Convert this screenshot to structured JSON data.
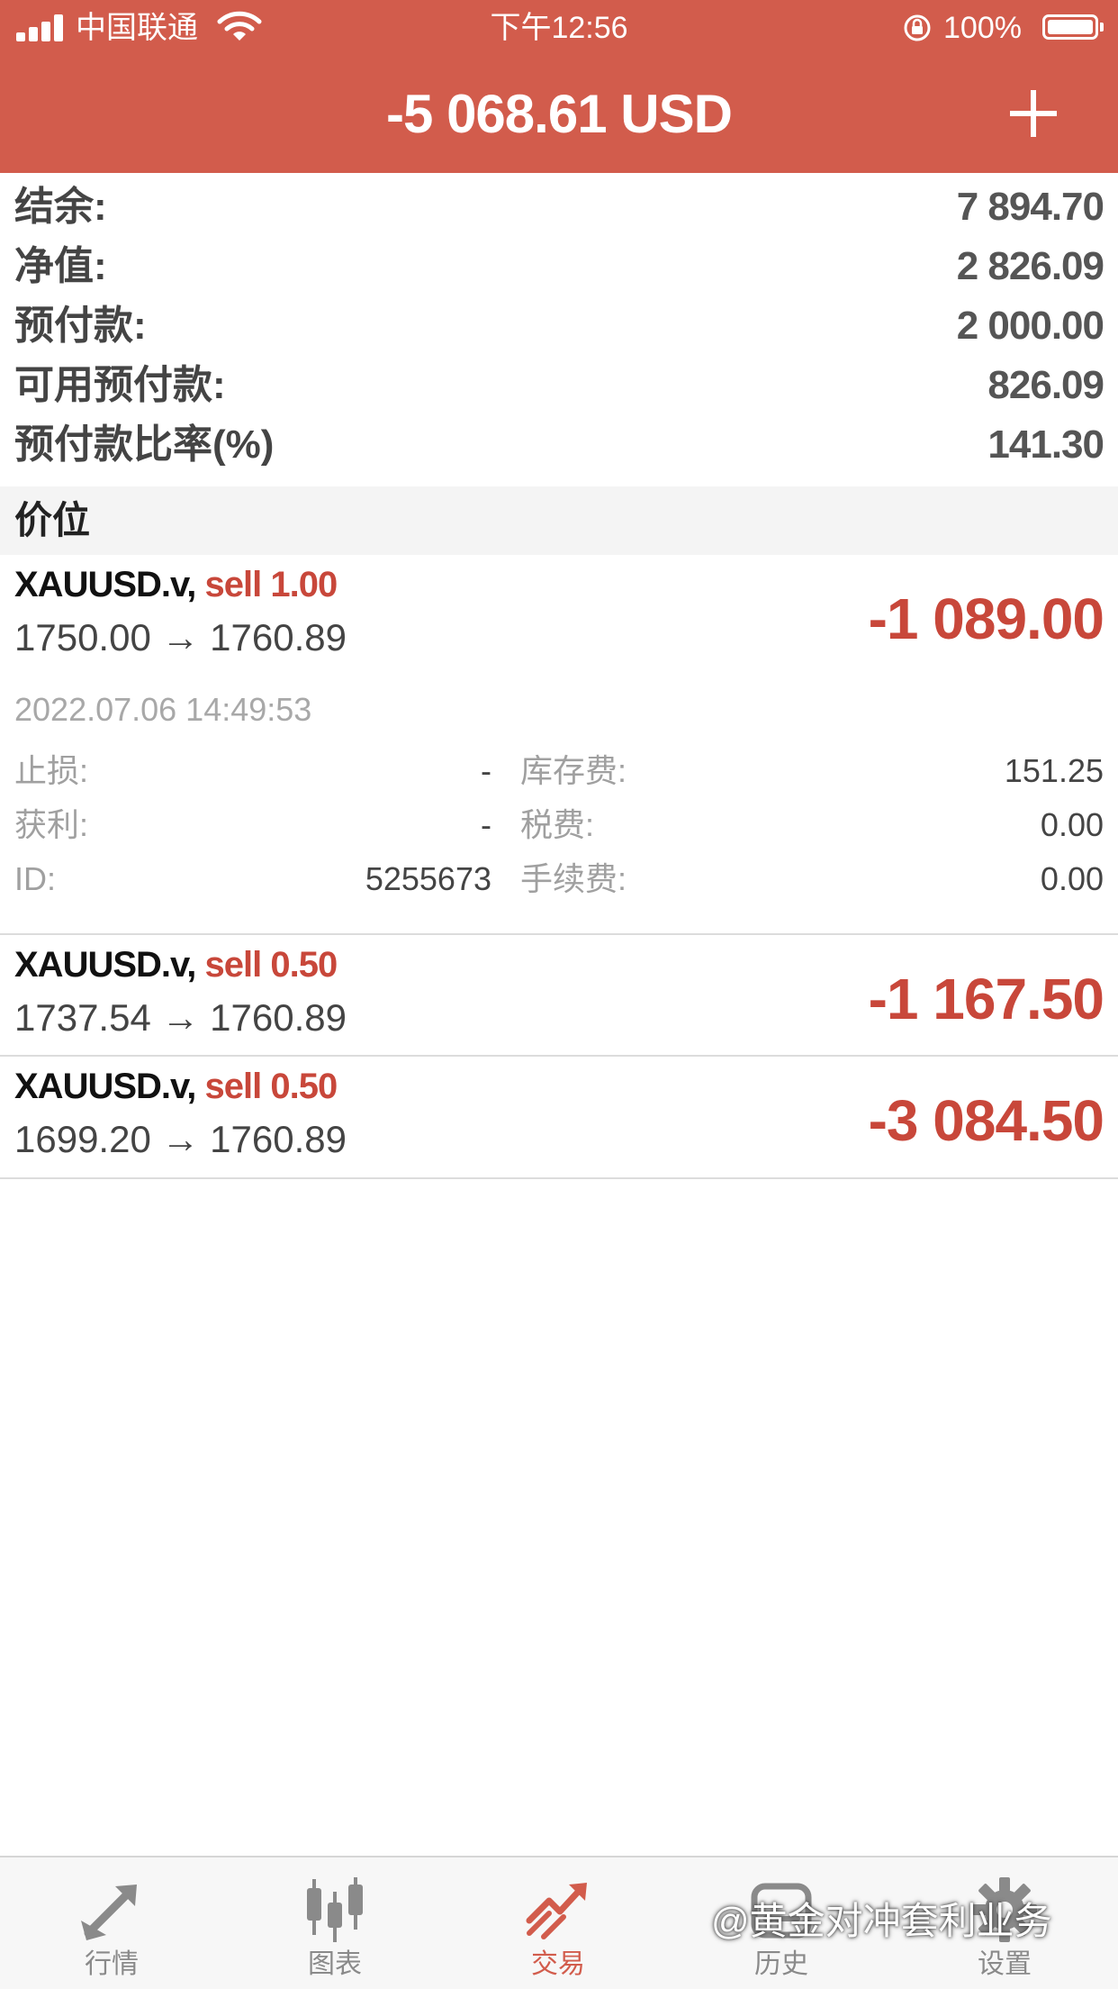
{
  "status_bar": {
    "carrier": "中国联通",
    "time": "下午12:56",
    "battery": "100%"
  },
  "header": {
    "total": "-5 068.61 USD"
  },
  "summary": [
    {
      "label": "结余:",
      "value": "7 894.70"
    },
    {
      "label": "净值:",
      "value": "2 826.09"
    },
    {
      "label": "预付款:",
      "value": "2 000.00"
    },
    {
      "label": "可用预付款:",
      "value": "826.09"
    },
    {
      "label": "预付款比率(%)",
      "value": "141.30"
    }
  ],
  "section": {
    "title": "价位"
  },
  "positions": [
    {
      "symbol": "XAUUSD.v,",
      "side": "sell 1.00",
      "prices": "1750.00 → 1760.89",
      "profit": "-1 089.00",
      "time": "2022.07.06 14:49:53",
      "details": {
        "sl_label": "止损:",
        "sl_value": "-",
        "tp_label": "获利:",
        "tp_value": "-",
        "id_label": "ID:",
        "id_value": "5255673",
        "swap_label": "库存费:",
        "swap_value": "151.25",
        "tax_label": "税费:",
        "tax_value": "0.00",
        "fee_label": "手续费:",
        "fee_value": "0.00"
      }
    },
    {
      "symbol": "XAUUSD.v,",
      "side": "sell 0.50",
      "prices": "1737.54 → 1760.89",
      "profit": "-1 167.50"
    },
    {
      "symbol": "XAUUSD.v,",
      "side": "sell 0.50",
      "prices": "1699.20 → 1760.89",
      "profit": "-3 084.50"
    }
  ],
  "tabs": [
    {
      "label": "行情",
      "icon": "quotes-arrows-icon"
    },
    {
      "label": "图表",
      "icon": "candlestick-chart-icon"
    },
    {
      "label": "交易",
      "icon": "trade-trend-icon"
    },
    {
      "label": "历史",
      "icon": "history-icon"
    },
    {
      "label": "设置",
      "icon": "gear-icon"
    }
  ],
  "active_tab": "交易",
  "watermark": "@黄金对冲套利业务",
  "colors": {
    "header": "#d25c4c",
    "loss": "#c8473a",
    "active_tab": "#d25c4c",
    "inactive_tab": "#8a8a8a"
  }
}
